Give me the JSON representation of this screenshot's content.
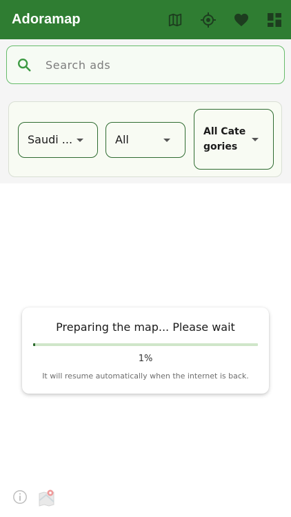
{
  "header": {
    "title": "Adoramap",
    "background": "#2f7d32",
    "actions": [
      {
        "icon": "map-icon"
      },
      {
        "icon": "my-location-icon"
      },
      {
        "icon": "favorite-heart-icon"
      },
      {
        "icon": "dashboard-icon"
      }
    ]
  },
  "search": {
    "placeholder": "Search ads",
    "value": ""
  },
  "filters": {
    "country": "Saudi ...",
    "region": "All",
    "category": "All Categories"
  },
  "loading": {
    "title": "Preparing the map... Please wait",
    "progress_percent": 1,
    "progress_label": "1%",
    "note": "It will resume automatically when the internet is back."
  },
  "footer": {
    "icons": [
      "info-icon",
      "map-logo-icon"
    ]
  },
  "colors": {
    "primary": "#2f7d32",
    "accent_border": "#66bb6a",
    "progress_track": "#cfe6c9",
    "progress_fill": "#2e6b30"
  }
}
